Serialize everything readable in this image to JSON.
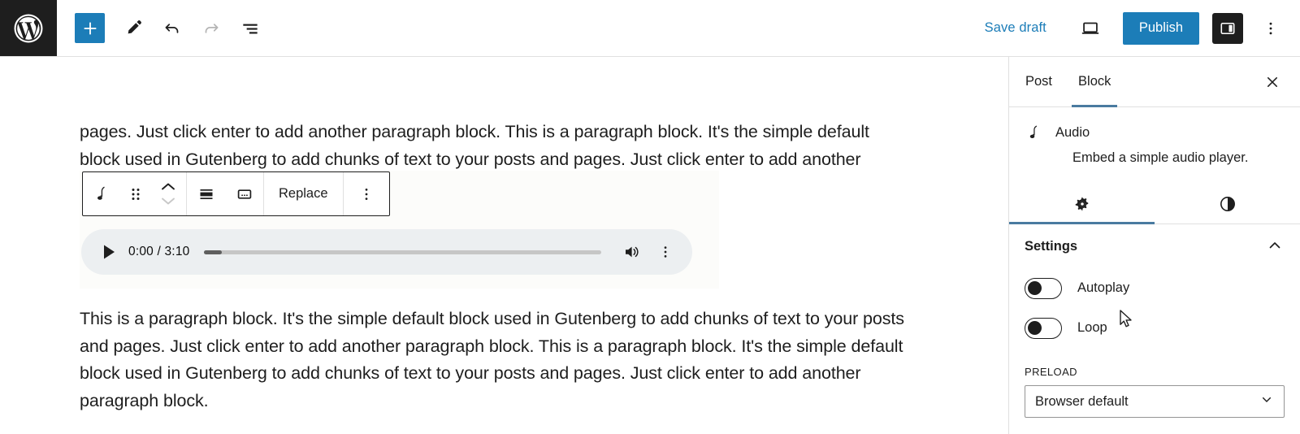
{
  "header": {
    "logo_icon": "wordpress-logo-icon",
    "add_block_icon": "plus-icon",
    "add_block_label": "Add block",
    "tools_icon": "pencil-edit-icon",
    "undo_icon": "undo-arrow-icon",
    "redo_icon": "redo-arrow-icon",
    "list_view_icon": "document-outline-icon",
    "save_draft_label": "Save draft",
    "preview_icon": "laptop-preview-icon",
    "publish_label": "Publish",
    "sidebar_toggle_icon": "sidebar-panel-icon",
    "more_options_icon": "kebab-vertical-icon",
    "accent_color": "#1c7db8",
    "logo_bg_color": "#1e1e1e"
  },
  "editor": {
    "paragraph_top": "pages. Just click enter to add another paragraph block. This is a paragraph block. It's the simple default block used in Gutenberg to add chunks of text to your posts and pages. Just click enter to add another paragraph",
    "paragraph_bottom": "This is a paragraph block. It's the simple default block used in Gutenberg to add chunks of text to your posts and pages. Just click enter to add another paragraph block. This is a paragraph block. It's the simple default block used in Gutenberg to add chunks of text to your posts and pages. Just click enter to add another paragraph block.",
    "block_toolbar": {
      "block_type_icon": "audio-note-icon",
      "drag_handle_icon": "drag-dots-icon",
      "move_up_icon": "chevron-up-icon",
      "move_down_icon": "chevron-down-icon",
      "align_icon": "align-wide-icon",
      "caption_icon": "add-caption-icon",
      "replace_label": "Replace",
      "more_icon": "kebab-vertical-icon"
    },
    "audio_player": {
      "play_icon": "play-triangle-icon",
      "time_display": "0:00 / 3:10",
      "current_time": "0:00",
      "duration": "3:10",
      "progress_percent": 4.5,
      "volume_icon": "speaker-volume-icon",
      "menu_icon": "kebab-vertical-icon",
      "track_color": "#c6c6c6",
      "progress_color": "#5f5f5f",
      "background_color": "#eceff1"
    }
  },
  "sidebar": {
    "tabs": [
      {
        "label": "Post",
        "active": false
      },
      {
        "label": "Block",
        "active": true
      }
    ],
    "close_icon": "close-x-icon",
    "block_card": {
      "icon": "audio-note-icon",
      "title": "Audio",
      "description": "Embed a simple audio player."
    },
    "icon_tabs": [
      {
        "icon": "gear-settings-icon",
        "active": true
      },
      {
        "icon": "contrast-styles-icon",
        "active": false
      }
    ],
    "panel": {
      "title": "Settings",
      "collapse_icon": "chevron-up-icon",
      "toggles": [
        {
          "label": "Autoplay",
          "on": false
        },
        {
          "label": "Loop",
          "on": false
        }
      ],
      "preload_label": "PRELOAD",
      "preload_value": "Browser default",
      "preload_chevron_icon": "chevron-down-icon"
    },
    "active_tab_color": "#4a7ba0"
  },
  "cursor": {
    "icon": "mouse-pointer-icon"
  }
}
